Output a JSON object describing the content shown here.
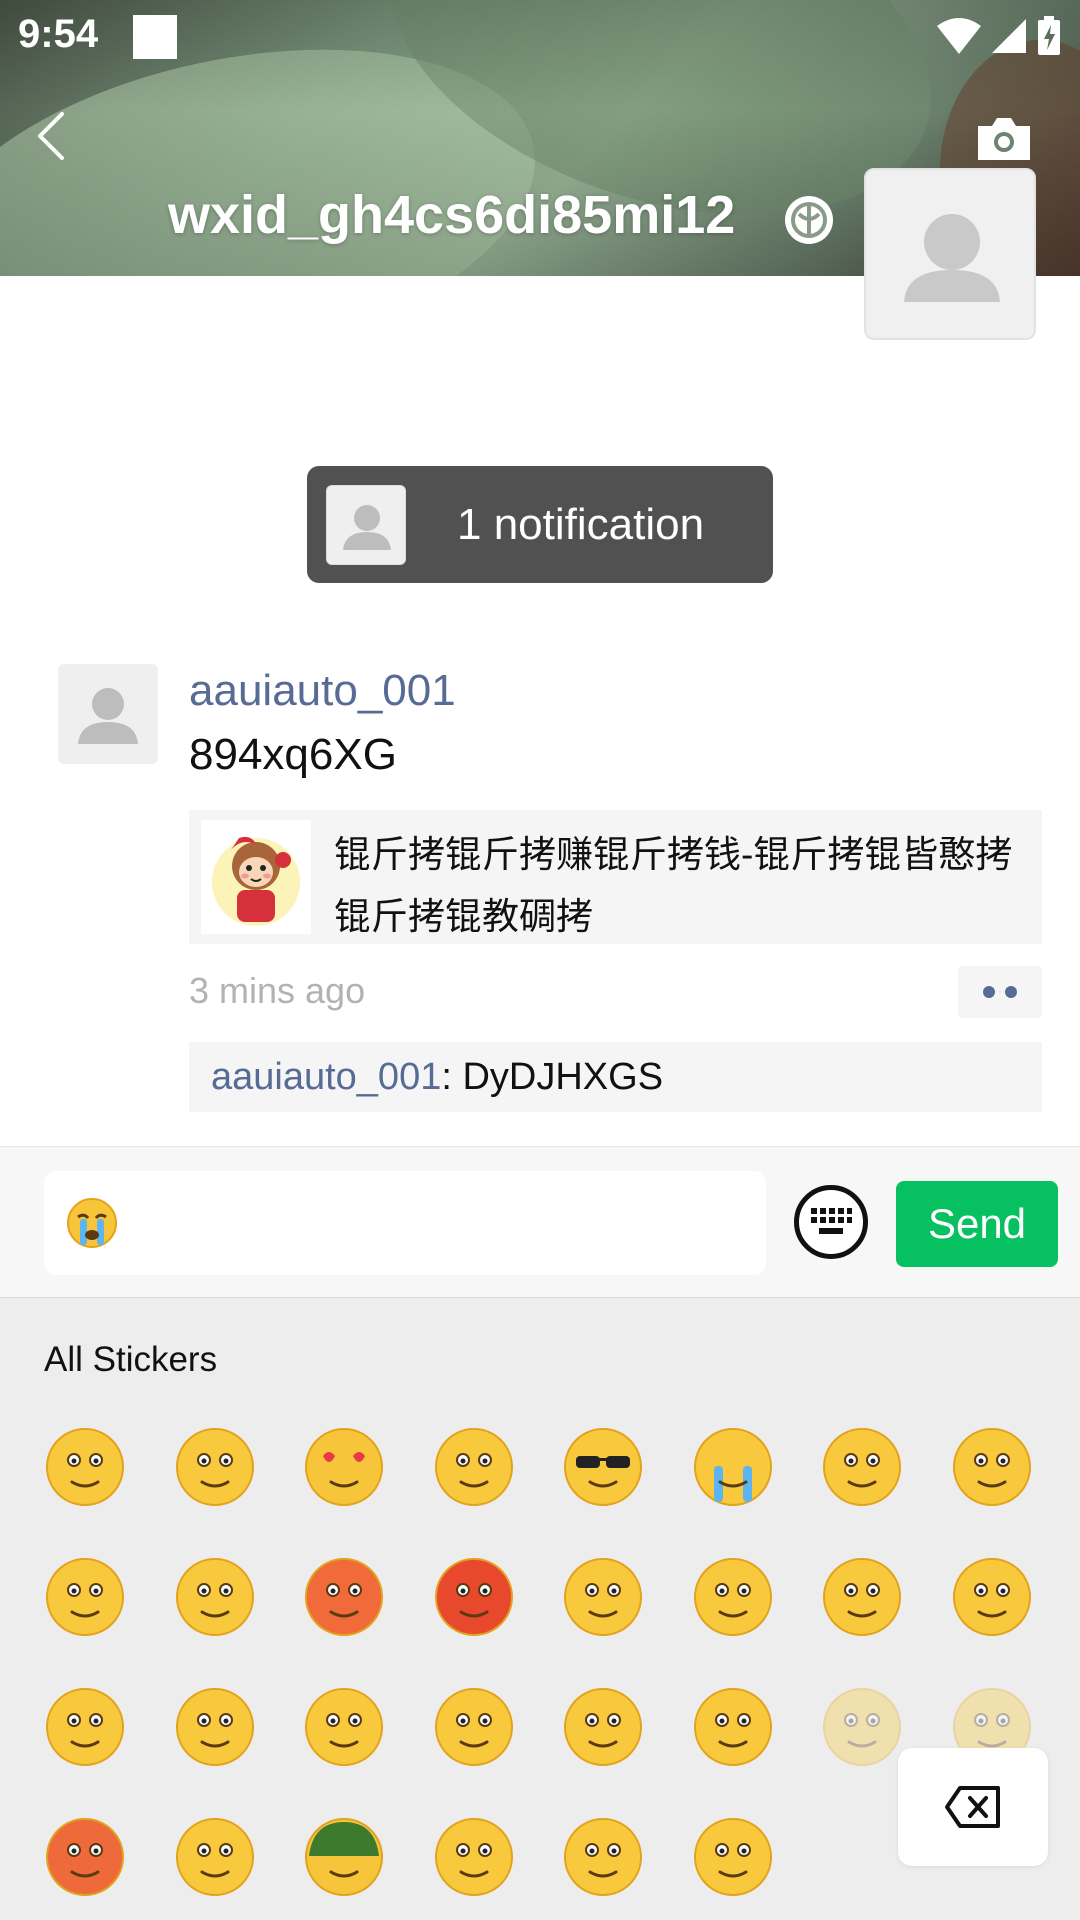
{
  "status_bar": {
    "time": "9:54"
  },
  "header": {
    "profile_name": "wxid_gh4cs6di85mi12"
  },
  "notification": {
    "label": "1 notification"
  },
  "post": {
    "author": "aauiauto_001",
    "text": "894xq6XG",
    "link_title": "锟斤拷锟斤拷赚锟斤拷钱-锟斤拷锟皆憨拷锟斤拷锟教碉拷",
    "time": "3 mins ago",
    "comment": {
      "author": "aauiauto_001",
      "separator": ": ",
      "text": "DyDJHXGS"
    }
  },
  "input": {
    "current_value": "😭",
    "send_label": "Send"
  },
  "stickers": {
    "title": "All Stickers",
    "items": [
      "smile",
      "awkward",
      "heart-eyes",
      "stare",
      "cool-sunglasses",
      "sob",
      "shy",
      "shut-mouth",
      "sleep",
      "cry-laugh",
      "embarrassed",
      "angry",
      "tongue",
      "grin",
      "surprised",
      "sad",
      "blush",
      "laugh",
      "sick",
      "cover-mouth",
      "pleased",
      "wow",
      "eye-roll",
      "yawn",
      "frustrated",
      "happy",
      "soldier-helmet",
      "scold",
      "question",
      "shh"
    ]
  }
}
